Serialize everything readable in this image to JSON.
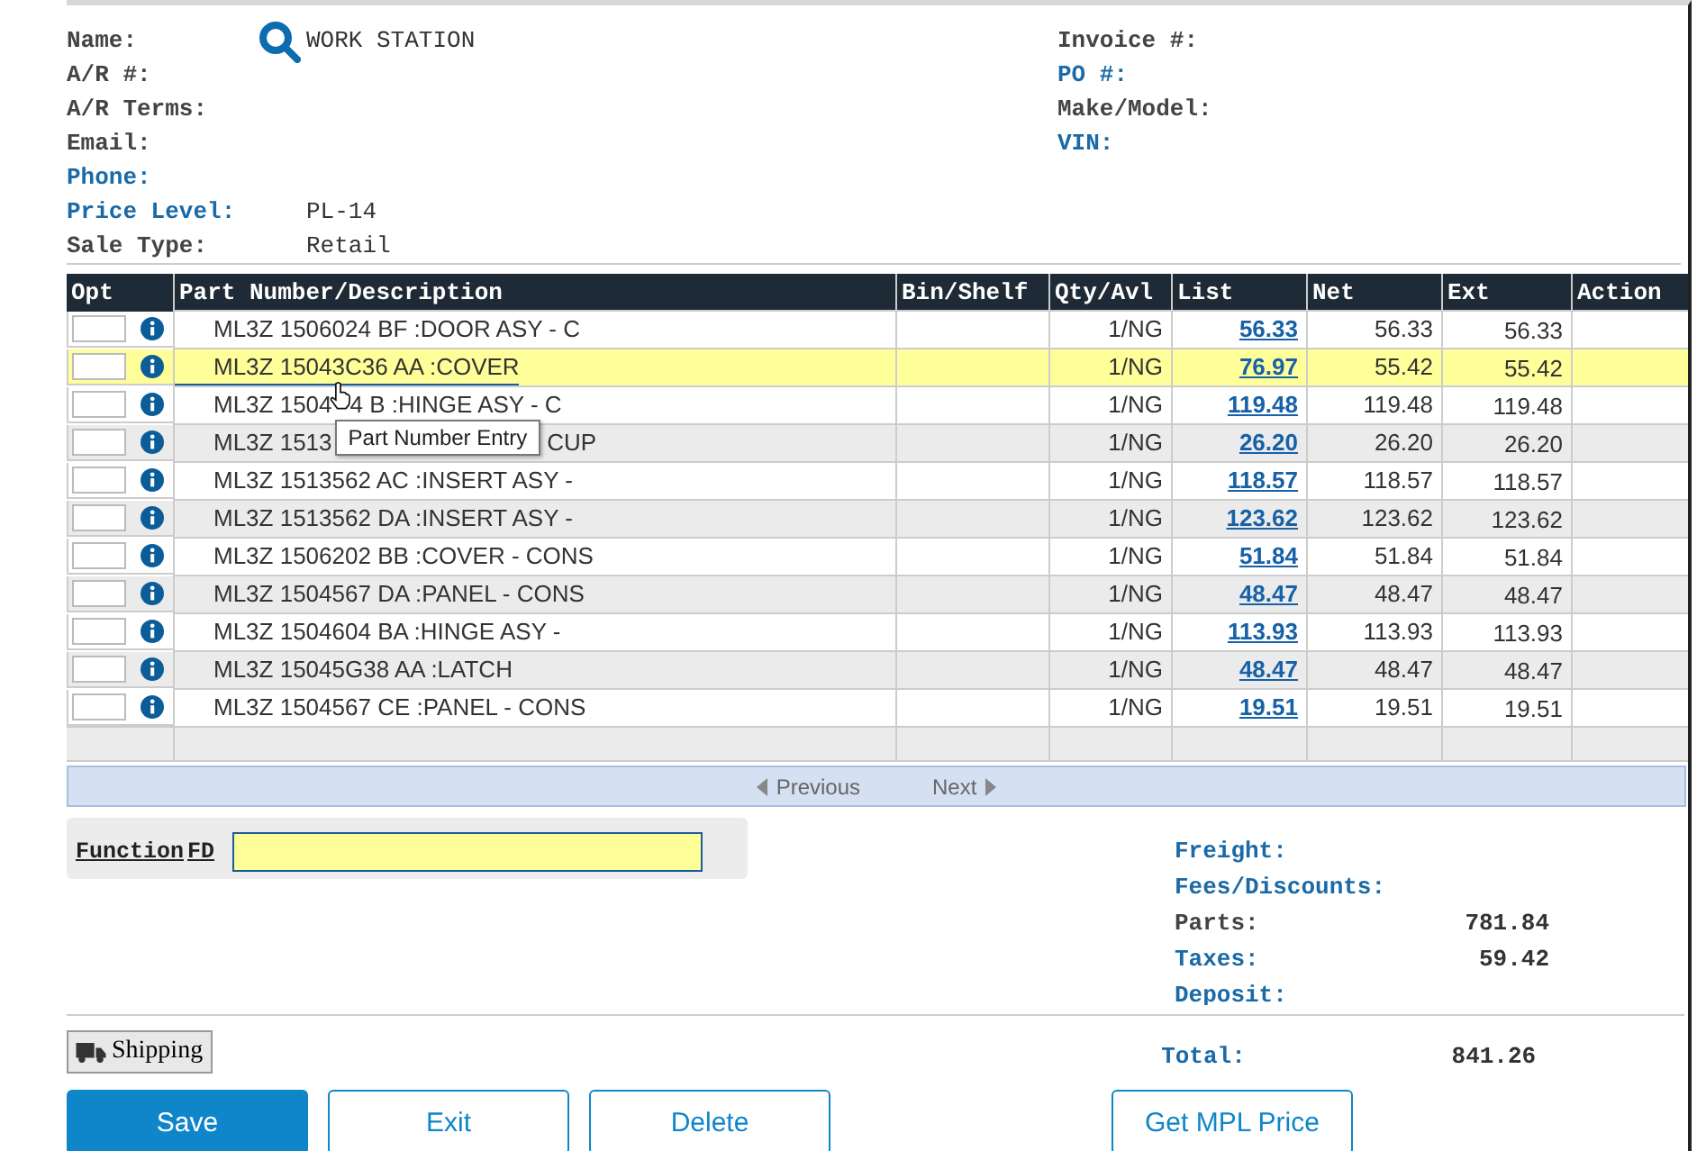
{
  "customer": {
    "fields": [
      {
        "label": "Name:",
        "value": "WORK STATION",
        "kind": "plain",
        "search": true
      },
      {
        "label": "A/R #:",
        "kind": "plain"
      },
      {
        "label": "A/R Terms:",
        "kind": "plain"
      },
      {
        "label": "Email:",
        "kind": "plain"
      },
      {
        "label": "Phone:",
        "kind": "linked"
      },
      {
        "label": "Price Level:",
        "value": "PL-14",
        "kind": "linked"
      },
      {
        "label": "Sale Type:",
        "value": "Retail",
        "kind": "plain"
      }
    ]
  },
  "invoice": {
    "fields": [
      {
        "label": "Invoice #:",
        "kind": "plain"
      },
      {
        "label": "PO #:",
        "kind": "linked"
      },
      {
        "label": "Make/Model:",
        "kind": "plain"
      },
      {
        "label": "VIN:",
        "kind": "linked"
      }
    ]
  },
  "table": {
    "columns": [
      "Opt",
      "Part Number/Description",
      "Bin/Shelf",
      "Qty/Avl",
      "List",
      "Net",
      "Ext",
      "Action"
    ],
    "rows": [
      {
        "desc": [
          "ML3Z 1506024 BF :DOOR ASY - C"
        ],
        "qty": "1/NG",
        "list": "56.33",
        "net": "56.33",
        "ext": "56.33",
        "selected": false
      },
      {
        "desc": [
          "ML3Z 15043C36 AA :COVER"
        ],
        "qty": "1/NG",
        "list": "76.97",
        "net": "55.42",
        "ext": "55.42",
        "selected": true
      },
      {
        "desc": [
          "ML3Z 1504",
          "4 B :HINGE ASY - C"
        ],
        "pointer": true,
        "qty": "1/NG",
        "list": "119.48",
        "net": "119.48",
        "ext": "119.48",
        "selected": false
      },
      {
        "desc": [
          "ML3Z 1513",
          "CUP"
        ],
        "tooltip": "Part Number Entry",
        "qty": "1/NG",
        "list": "26.20",
        "net": "26.20",
        "ext": "26.20",
        "selected": false
      },
      {
        "desc": [
          "ML3Z 1513562 AC :INSERT ASY -"
        ],
        "qty": "1/NG",
        "list": "118.57",
        "net": "118.57",
        "ext": "118.57",
        "selected": false
      },
      {
        "desc": [
          "ML3Z 1513562 DA :INSERT ASY -"
        ],
        "qty": "1/NG",
        "list": "123.62",
        "net": "123.62",
        "ext": "123.62",
        "selected": false
      },
      {
        "desc": [
          "ML3Z 1506202 BB :COVER - CONS"
        ],
        "qty": "1/NG",
        "list": "51.84",
        "net": "51.84",
        "ext": "51.84",
        "selected": false
      },
      {
        "desc": [
          "ML3Z 1504567 DA :PANEL - CONS"
        ],
        "qty": "1/NG",
        "list": "48.47",
        "net": "48.47",
        "ext": "48.47",
        "selected": false
      },
      {
        "desc": [
          "ML3Z 1504604 BA :HINGE ASY -"
        ],
        "qty": "1/NG",
        "list": "113.93",
        "net": "113.93",
        "ext": "113.93",
        "selected": false
      },
      {
        "desc": [
          "ML3Z 15045G38 AA :LATCH"
        ],
        "qty": "1/NG",
        "list": "48.47",
        "net": "48.47",
        "ext": "48.47",
        "selected": false
      },
      {
        "desc": [
          "ML3Z 1504567 CE :PANEL - CONS"
        ],
        "qty": "1/NG",
        "list": "19.51",
        "net": "19.51",
        "ext": "19.51",
        "selected": false
      }
    ]
  },
  "pager": {
    "previous": "Previous",
    "next": "Next"
  },
  "function_entry": {
    "label": "Function",
    "code": "FD"
  },
  "totals": [
    {
      "label": "Freight:",
      "kind": "linked"
    },
    {
      "label": "Fees/Discounts:",
      "kind": "linked"
    },
    {
      "label": "Parts:",
      "value": "781.84",
      "kind": "plain"
    },
    {
      "label": "Taxes:",
      "value": "59.42",
      "kind": "linked"
    },
    {
      "label": "Deposit:",
      "kind": "linked"
    }
  ],
  "total": {
    "label": "Total:",
    "value": "841.26",
    "kind": "linked"
  },
  "shipping_button": "Shipping",
  "buttons": [
    {
      "label": "Save",
      "kind": "primary"
    },
    {
      "label": "Exit",
      "kind": "outline"
    },
    {
      "label": "Delete",
      "kind": "outline"
    },
    {
      "label": "Get MPL Price",
      "kind": "outline"
    }
  ]
}
